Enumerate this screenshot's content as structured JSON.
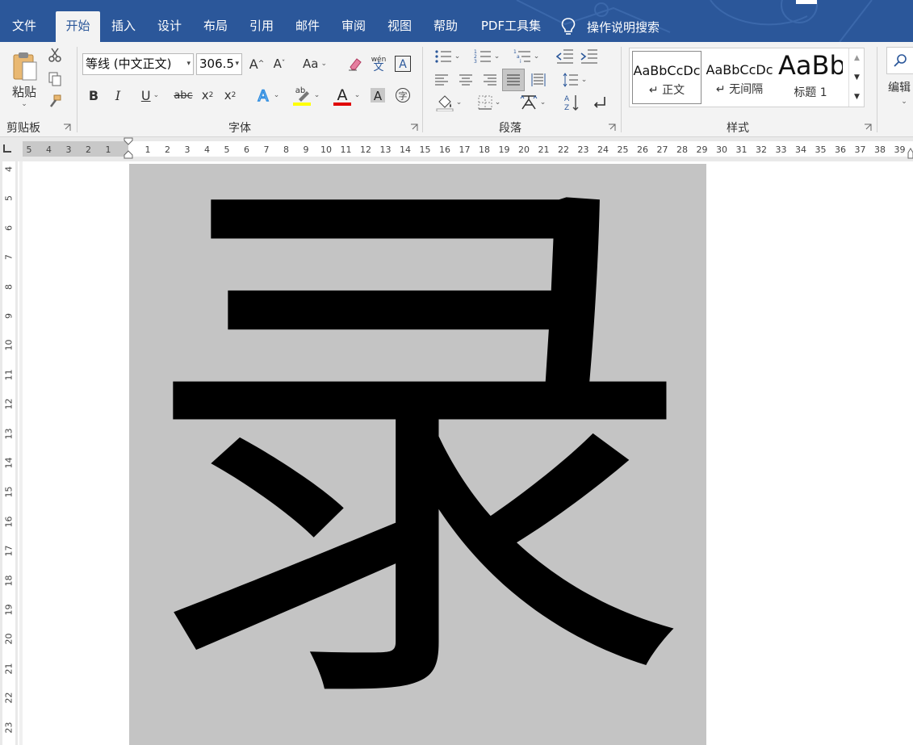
{
  "tabs": {
    "file": "文件",
    "home": "开始",
    "insert": "插入",
    "design": "设计",
    "layout": "布局",
    "references": "引用",
    "mailings": "邮件",
    "review": "审阅",
    "view": "视图",
    "help": "帮助",
    "pdf": "PDF工具集",
    "tell_me": "操作说明搜索"
  },
  "ribbon": {
    "clipboard": {
      "paste_label": "粘贴",
      "group_label": "剪贴板"
    },
    "font": {
      "font_name": "等线 (中文正文)",
      "font_size": "306.5",
      "grow_icon": "A",
      "shrink_icon": "A",
      "change_case": "Aa",
      "phonetic_top": "wén",
      "phonetic_bottom": "文",
      "bold": "B",
      "italic": "I",
      "underline": "U",
      "strike": "abc",
      "subscript": "x",
      "superscript": "x",
      "group_label": "字体",
      "highlight_color": "#ffff00",
      "font_color": "#e00000"
    },
    "paragraph": {
      "group_label": "段落"
    },
    "styles": {
      "group_label": "样式",
      "items": [
        {
          "sample": "AaBbCcDc",
          "name": "正文"
        },
        {
          "sample": "AaBbCcDc",
          "name": "无间隔"
        },
        {
          "sample": "AaBb",
          "name": "标题 1"
        }
      ]
    },
    "editing": {
      "label": "编辑"
    }
  },
  "ruler": {
    "h_left": [
      "5",
      "4",
      "3",
      "2",
      "1"
    ],
    "h_right": [
      "1",
      "2",
      "3",
      "4",
      "5",
      "6",
      "7",
      "8",
      "9",
      "10",
      "11",
      "12",
      "13",
      "14",
      "15",
      "16",
      "17",
      "18",
      "19",
      "20",
      "21",
      "22",
      "23",
      "24",
      "25",
      "26",
      "27",
      "28",
      "29",
      "30",
      "31",
      "32",
      "33",
      "34",
      "35",
      "36",
      "37",
      "38",
      "39"
    ],
    "v": [
      "4",
      "5",
      "6",
      "7",
      "8",
      "9",
      "10",
      "11",
      "12",
      "13",
      "14",
      "15",
      "16",
      "17",
      "18",
      "19",
      "20",
      "21",
      "22",
      "23"
    ]
  },
  "document": {
    "character": "录",
    "highlight_color": "#c4c4c4"
  },
  "colors": {
    "accent": "#2b579a"
  }
}
